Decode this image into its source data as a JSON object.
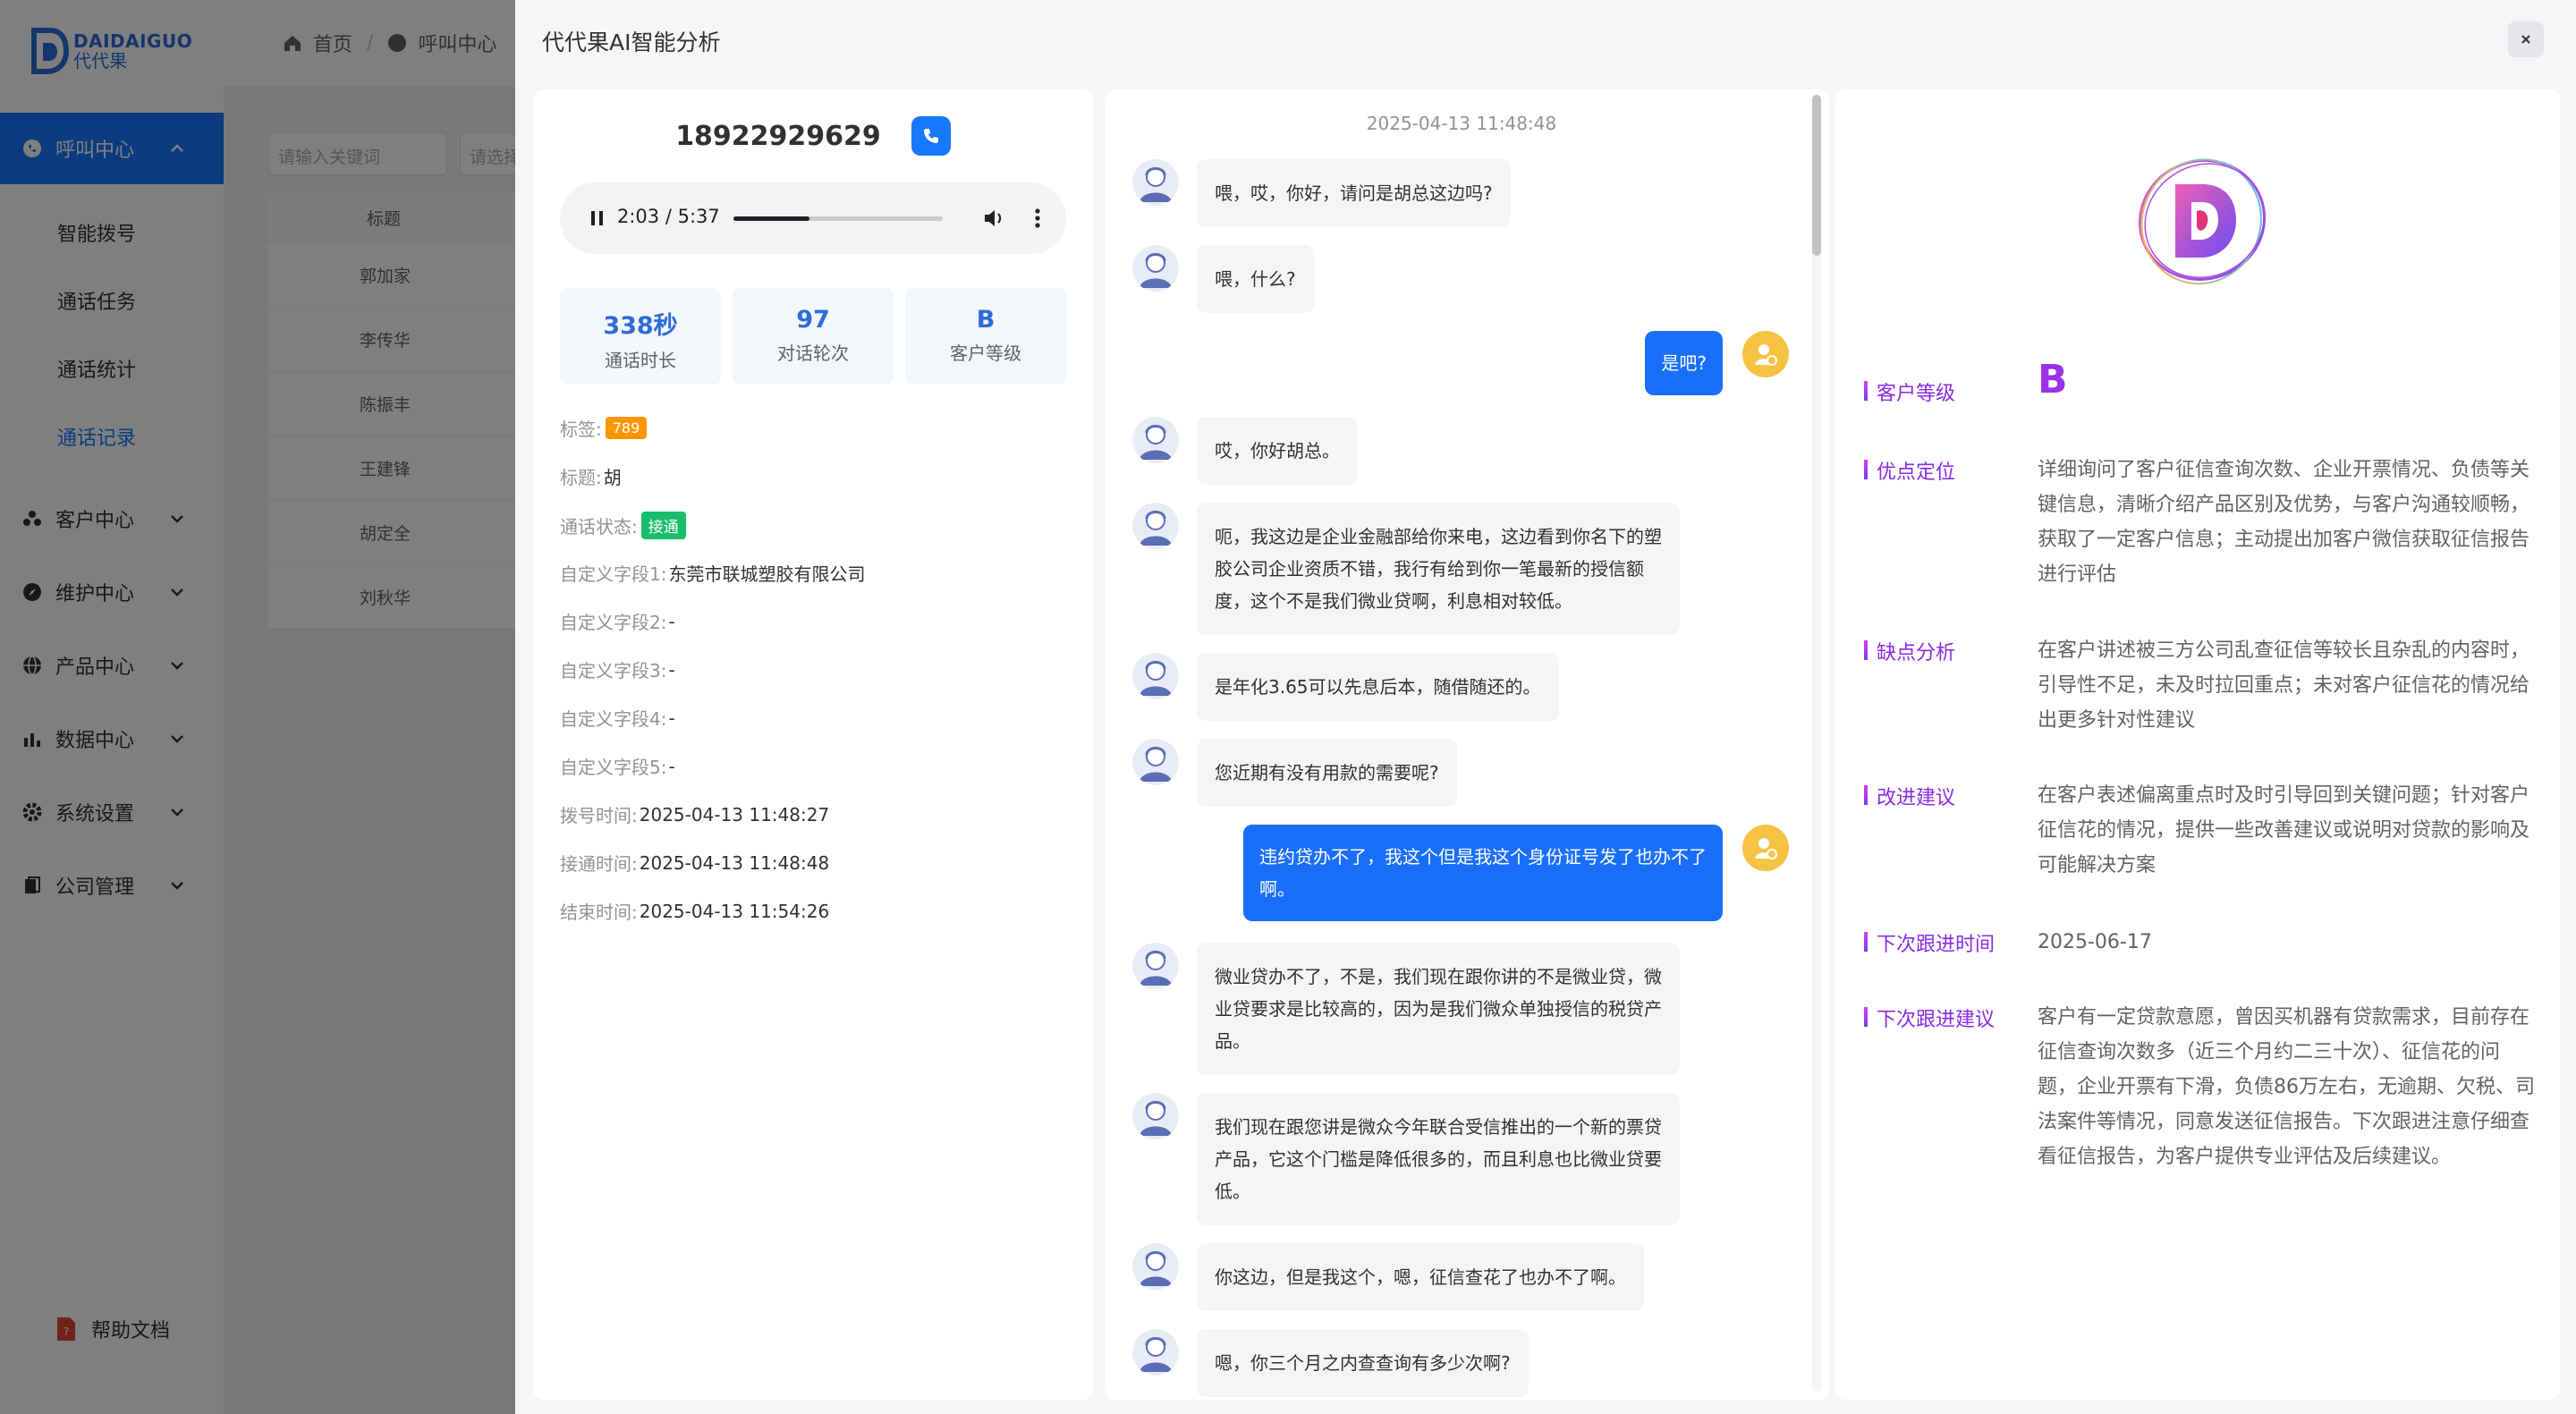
{
  "sidebar": {
    "logo_en": "DAIDAIGUO",
    "logo_cn": "代代果",
    "groups": [
      {
        "label": "呼叫中心",
        "icon": "phone-circle-icon",
        "expanded": true
      },
      {
        "label": "客户中心",
        "icon": "customers-icon",
        "expanded": false
      },
      {
        "label": "维护中心",
        "icon": "compass-icon",
        "expanded": false
      },
      {
        "label": "产品中心",
        "icon": "globe-icon",
        "expanded": false
      },
      {
        "label": "数据中心",
        "icon": "bar-chart-icon",
        "expanded": false
      },
      {
        "label": "系统设置",
        "icon": "gear-icon",
        "expanded": false
      },
      {
        "label": "公司管理",
        "icon": "building-icon",
        "expanded": false
      }
    ],
    "sub_items": [
      "智能拨号",
      "通话任务",
      "通话统计",
      "通话记录"
    ],
    "selected_sub": "通话记录",
    "help_label": "帮助文档"
  },
  "main": {
    "breadcrumb": [
      "首页",
      "呼叫中心"
    ],
    "filter_placeholder": "请输入关键词",
    "filter_placeholder2": "请选择",
    "table_header": "标题",
    "table_rows": [
      "郭加家",
      "李传华",
      "陈振丰",
      "王建锋",
      "胡定全",
      "刘秋华"
    ]
  },
  "drawer": {
    "title": "代代果AI智能分析",
    "phone": "18922929629",
    "audio": {
      "current": "2:03",
      "total": "5:37",
      "progress": 0.365,
      "time_text": "2:03 / 5:37"
    },
    "stats": [
      {
        "value": "338秒",
        "label": "通话时长"
      },
      {
        "value": "97",
        "label": "对话轮次"
      },
      {
        "value": "B",
        "label": "客户等级"
      }
    ],
    "fields": {
      "tag_label": "标签:",
      "tag_value": "789",
      "title_label": "标题:",
      "title_value": "胡",
      "status_label": "通话状态:",
      "status_value": "接通",
      "custom1_label": "自定义字段1:",
      "custom1_value": "东莞市联城塑胶有限公司",
      "custom2_label": "自定义字段2:",
      "custom2_value": "-",
      "custom3_label": "自定义字段3:",
      "custom3_value": "-",
      "custom4_label": "自定义字段4:",
      "custom4_value": "-",
      "custom5_label": "自定义字段5:",
      "custom5_value": "-",
      "dial_label": "拨号时间:",
      "dial_value": "2025-04-13 11:48:27",
      "connect_label": "接通时间:",
      "connect_value": "2025-04-13 11:48:48",
      "end_label": "结束时间:",
      "end_value": "2025-04-13 11:54:26"
    },
    "chat": {
      "date": "2025-04-13 11:48:48",
      "messages": [
        {
          "side": "in",
          "lines": [
            "喂，哎，你好，请问是胡总这边吗?"
          ]
        },
        {
          "side": "in",
          "lines": [
            "喂，什么?"
          ]
        },
        {
          "side": "out",
          "lines": [
            "是吧?"
          ]
        },
        {
          "side": "in",
          "lines": [
            "哎，你好胡总。"
          ]
        },
        {
          "side": "in",
          "lines": [
            "呃，我这边是企业金融部给你来电，这边看到你名下的塑",
            "胶公司企业资质不错，我行有给到你一笔最新的授信额",
            "度，这个不是我们微业贷啊，利息相对较低。"
          ]
        },
        {
          "side": "in",
          "lines": [
            "是年化3.65可以先息后本，随借随还的。"
          ]
        },
        {
          "side": "in",
          "lines": [
            "您近期有没有用款的需要呢?"
          ]
        },
        {
          "side": "out",
          "lines": [
            "违约贷办不了，我这个但是我这个身份证号发了也办不了",
            "啊。"
          ]
        },
        {
          "side": "in",
          "lines": [
            "微业贷办不了，不是，我们现在跟你讲的不是微业贷，微",
            "业贷要求是比较高的，因为是我们微众单独授信的税贷产",
            "品。"
          ]
        },
        {
          "side": "in",
          "lines": [
            "我们现在跟您讲是微众今年联合受信推出的一个新的票贷",
            "产品，它这个门槛是降低很多的，而且利息也比微业贷要",
            "低。"
          ]
        },
        {
          "side": "in",
          "lines": [
            "你这边，但是我这个，嗯，征信查花了也办不了啊。"
          ]
        },
        {
          "side": "in",
          "lines": [
            "嗯，你三个月之内查查询有多少次啊?"
          ]
        }
      ]
    },
    "analysis": {
      "grade_label": "客户等级",
      "grade_value": "B",
      "strength_label": "优点定位",
      "strength_lines": [
        "详细询问了客户征信查询次数、企业开票情况、负债等关",
        "键信息，清晰介绍产品区别及优势，与客户沟通较顺畅，",
        "获取了一定客户信息；主动提出加客户微信获取征信报告",
        "进行评估"
      ],
      "weakness_label": "缺点分析",
      "weakness_lines": [
        "在客户讲述被三方公司乱查征信等较长且杂乱的内容时，",
        "引导性不足，未及时拉回重点；未对客户征信花的情况给",
        "出更多针对性建议"
      ],
      "improve_label": "改进建议",
      "improve_lines": [
        "在客户表述偏离重点时及时引导回到关键问题；针对客户",
        "征信花的情况，提供一些改善建议或说明对贷款的影响及",
        "可能解决方案"
      ],
      "next_time_label": "下次跟进时间",
      "next_time_value": "2025-06-17",
      "next_advice_label": "下次跟进建议",
      "next_advice_lines": [
        "客户有一定贷款意愿，曾因买机器有贷款需求，目前存在",
        "征信查询次数多（近三个月约二三十次）、征信花的问",
        "题，企业开票有下滑，负债86万左右，无逾期、欠税、司",
        "法案件等情况，同意发送征信报告。下次跟进注意仔细查",
        "看征信报告，为客户提供专业评估及后续建议。"
      ]
    }
  },
  "colors": {
    "accent": "#1677ff",
    "analysis_label": "#8a2be2",
    "tag_orange": "#ff9500",
    "status_green": "#19be6b"
  }
}
